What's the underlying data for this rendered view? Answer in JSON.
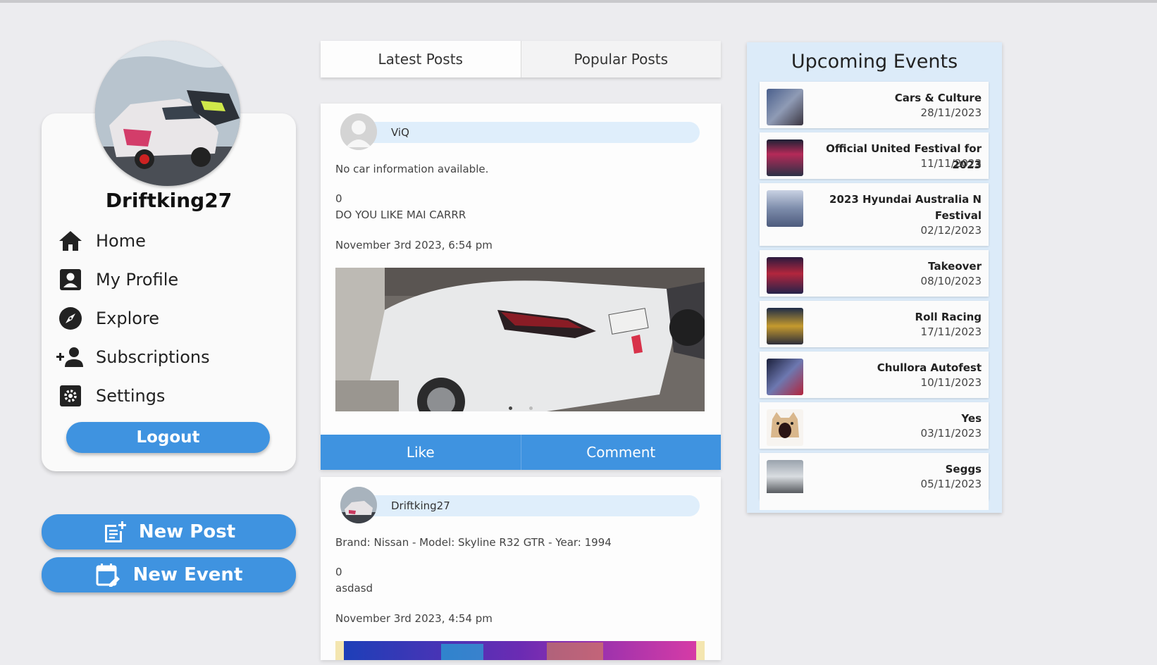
{
  "profile": {
    "username": "Driftking27"
  },
  "nav": {
    "items": [
      {
        "label": "Home",
        "icon": "home-icon"
      },
      {
        "label": "My Profile",
        "icon": "profile-icon"
      },
      {
        "label": "Explore",
        "icon": "compass-icon"
      },
      {
        "label": "Subscriptions",
        "icon": "add-person-icon"
      },
      {
        "label": "Settings",
        "icon": "gear-icon"
      }
    ],
    "logout_label": "Logout"
  },
  "actions": {
    "new_post_label": "New Post",
    "new_event_label": "New Event"
  },
  "feed": {
    "tabs": [
      {
        "label": "Latest Posts",
        "active": true
      },
      {
        "label": "Popular Posts",
        "active": false
      }
    ],
    "posts": [
      {
        "author": "ViQ",
        "car_info": "No car information available.",
        "likes": "0",
        "caption": "DO YOU LIKE MAI CARRR",
        "timestamp": "November 3rd 2023, 6:54 pm",
        "like_label": "Like",
        "comment_label": "Comment"
      },
      {
        "author": "Driftking27",
        "car_info": "Brand: Nissan - Model: Skyline R32 GTR - Year: 1994",
        "likes": "0",
        "caption": "asdasd",
        "timestamp": "November 3rd 2023, 4:54 pm"
      }
    ]
  },
  "events": {
    "title": "Upcoming Events",
    "items": [
      {
        "name": "Cars & Culture",
        "date": "28/11/2023"
      },
      {
        "name": "Official United Festival for 2023",
        "date": "11/11/2023"
      },
      {
        "name": "2023 Hyundai Australia N Festival",
        "date": "02/12/2023"
      },
      {
        "name": "Takeover",
        "date": "08/10/2023"
      },
      {
        "name": "Roll Racing",
        "date": "17/11/2023"
      },
      {
        "name": "Chullora Autofest",
        "date": "10/11/2023"
      },
      {
        "name": "Yes",
        "date": "03/11/2023"
      },
      {
        "name": "Seggs",
        "date": "05/11/2023"
      }
    ]
  },
  "colors": {
    "accent": "#3f93e0",
    "page_bg": "#ececef",
    "events_bg": "#dcebf9",
    "name_pill": "#dfeefb"
  }
}
